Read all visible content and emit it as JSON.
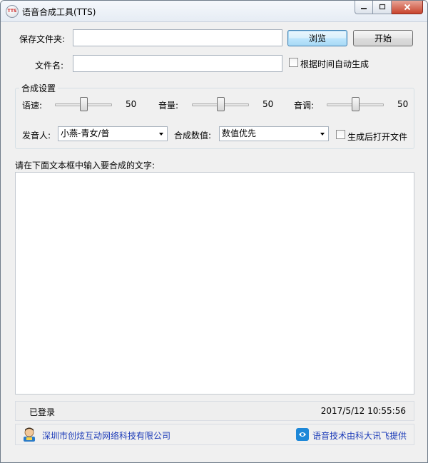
{
  "window": {
    "title": "语音合成工具(TTS)",
    "icon_text": "TTS"
  },
  "form": {
    "save_folder_label": "保存文件夹:",
    "save_folder_value": "",
    "browse_button": "浏览",
    "start_button": "开始",
    "filename_label": "文件名:",
    "filename_value": "",
    "auto_name_checkbox": "根据时间自动生成",
    "auto_name_checked": false
  },
  "synthesis": {
    "group_title": "合成设置",
    "speed_label": "语速:",
    "speed_value": "50",
    "volume_label": "音量:",
    "volume_value": "50",
    "pitch_label": "音调:",
    "pitch_value": "50",
    "speaker_label": "发音人:",
    "speaker_selected": "小燕-青女/普",
    "number_label": "合成数值:",
    "number_selected": "数值优先",
    "open_after_checkbox": "生成后打开文件",
    "open_after_checked": false
  },
  "input": {
    "prompt_label": "请在下面文本框中输入要合成的文字:",
    "text": ""
  },
  "status": {
    "login_text": "已登录",
    "datetime": "2017/5/12 10:55:56"
  },
  "footer": {
    "company_link": "深圳市创炫互动网络科技有限公司",
    "provider_link": "语音技术由科大讯飞提供"
  },
  "icons": {
    "app": "tts-app-icon",
    "company": "person-icon",
    "provider": "iflytek-icon"
  },
  "colors": {
    "link": "#1c3bb8",
    "close_button": "#c8442d",
    "focus_border": "#3c7fb1"
  }
}
